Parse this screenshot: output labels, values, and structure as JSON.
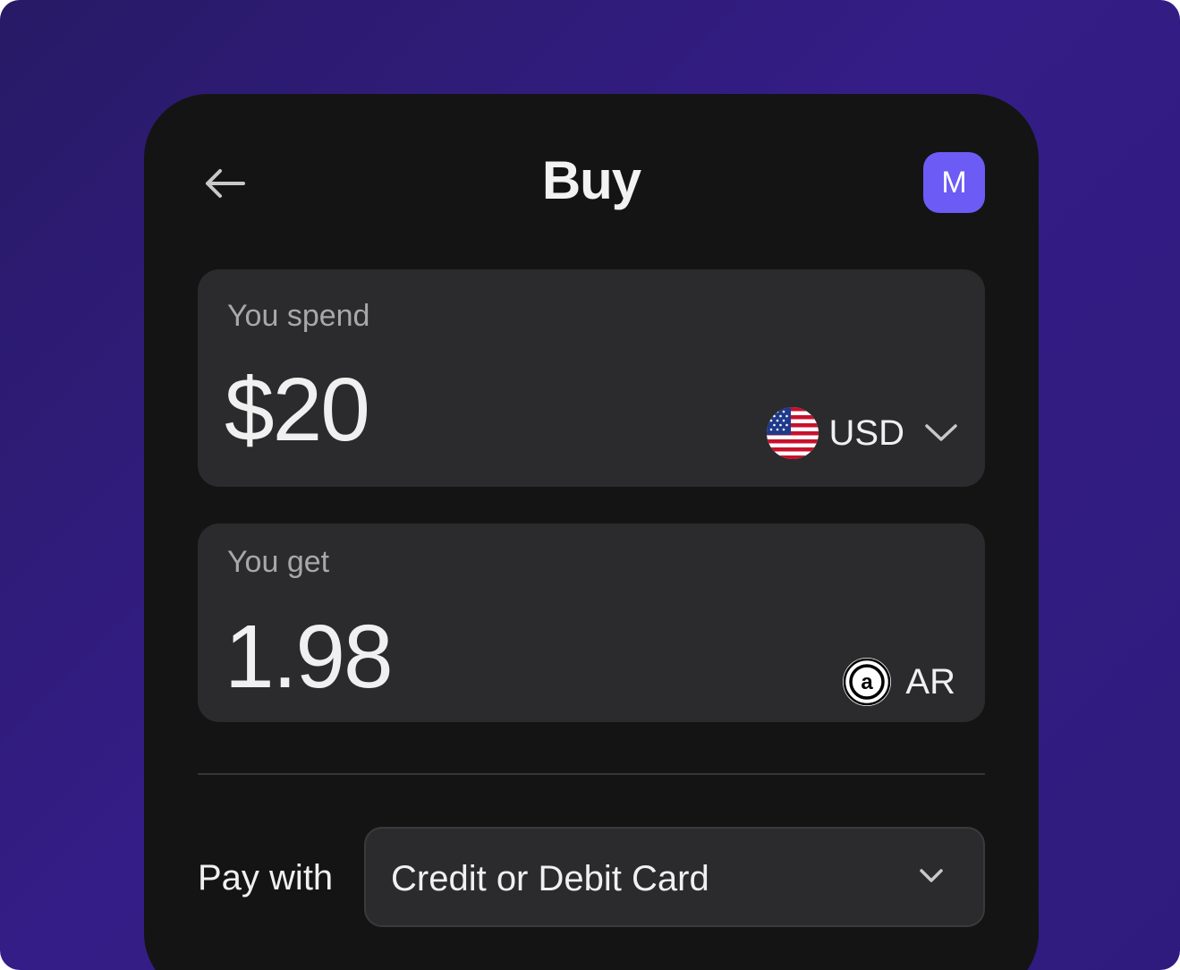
{
  "header": {
    "title": "Buy",
    "avatar_initial": "M"
  },
  "spend": {
    "label": "You spend",
    "amount": "$20",
    "currency": "USD",
    "currency_icon": "us-flag-icon"
  },
  "get": {
    "label": "You get",
    "amount": "1.98",
    "currency": "AR",
    "currency_icon": "arweave-logo-icon",
    "logo_letter": "a"
  },
  "payment": {
    "label": "Pay with",
    "selected": "Credit or Debit Card"
  },
  "colors": {
    "background": "#341d86",
    "panel": "#141414",
    "card": "#2b2b2d",
    "avatar": "#6c5bf5"
  }
}
